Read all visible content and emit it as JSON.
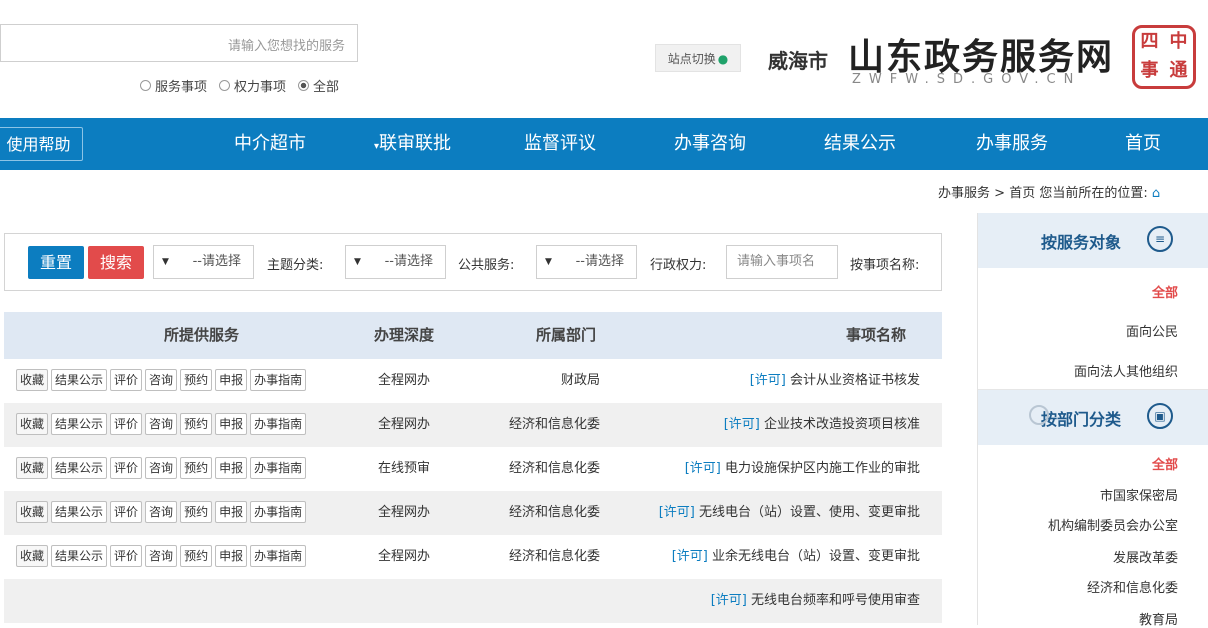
{
  "header": {
    "seal_chars": [
      "四",
      "中",
      "事",
      "通"
    ],
    "site_title": "山东政务服务网",
    "site_domain": "ZWFW.SD.GOV.CN",
    "city": "威海市",
    "city_switch": "站点切换",
    "search_placeholder": "请输入您想找的服务",
    "search_scopes": [
      {
        "label": "全部",
        "checked": true
      },
      {
        "label": "权力事项",
        "checked": false
      },
      {
        "label": "服务事项",
        "checked": false
      }
    ]
  },
  "nav": {
    "items": [
      "首页",
      "办事服务",
      "结果公示",
      "办事咨询",
      "监督评议",
      "联审联批",
      "中介超市"
    ],
    "help": "使用帮助"
  },
  "breadcrumb": {
    "prefix": "您当前所在的位置:",
    "home": "首页",
    "sep": ">",
    "current": "办事服务"
  },
  "filter": {
    "name_label": "按事项名称:",
    "name_placeholder": "请输入事项名",
    "power_label": "行政权力:",
    "power_value": "--请选择",
    "public_label": "公共服务:",
    "public_value": "--请选择",
    "theme_label": "主题分类:",
    "theme_value": "--请选择",
    "extra_value": "--请选择",
    "search_button": "搜索",
    "reset_button": "重置"
  },
  "table": {
    "headers": {
      "name": "事项名称",
      "dept": "所属部门",
      "depth": "办理深度",
      "services": "所提供服务"
    },
    "service_labels": [
      "办事指南",
      "申报",
      "预约",
      "咨询",
      "评价",
      "结果公示",
      "收藏"
    ],
    "rows": [
      {
        "name": "会计从业资格证书核发",
        "tag": "[许可]",
        "dept": "财政局",
        "depth": "全程网办",
        "show_services": true
      },
      {
        "name": "企业技术改造投资项目核准",
        "tag": "[许可]",
        "dept": "经济和信息化委",
        "depth": "全程网办",
        "show_services": true
      },
      {
        "name": "电力设施保护区内施工作业的审批",
        "tag": "[许可]",
        "dept": "经济和信息化委",
        "depth": "在线预审",
        "show_services": true
      },
      {
        "name": "无线电台（站）设置、使用、变更审批",
        "tag": "[许可]",
        "dept": "经济和信息化委",
        "depth": "全程网办",
        "show_services": true
      },
      {
        "name": "业余无线电台（站）设置、变更审批",
        "tag": "[许可]",
        "dept": "经济和信息化委",
        "depth": "全程网办",
        "show_services": true
      },
      {
        "name": "无线电台频率和呼号使用审查",
        "tag": "[许可]",
        "dept": "",
        "depth": "",
        "show_services": false
      }
    ]
  },
  "sidebar": {
    "by_object_title": "按服务对象",
    "object_items": [
      "全部",
      "面向公民",
      "面向法人其他组织"
    ],
    "by_dept_title": "按部门分类",
    "dept_items": [
      "全部",
      "市国家保密局",
      "机构编制委员会办公室",
      "发展改革委",
      "经济和信息化委",
      "教育局"
    ]
  }
}
